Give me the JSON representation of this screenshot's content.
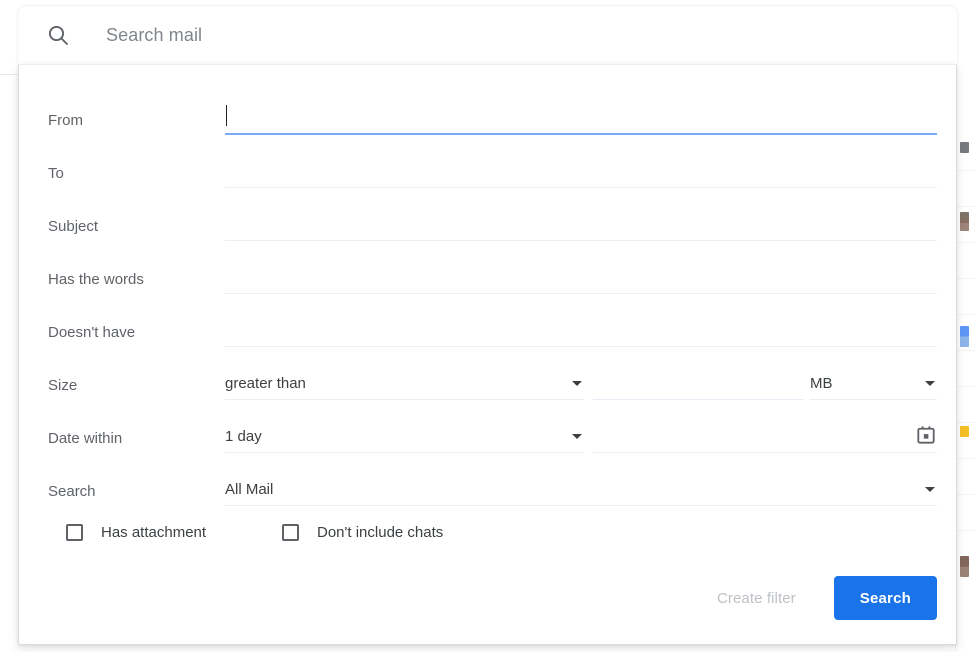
{
  "search_bar": {
    "icon": "search-icon",
    "placeholder": "Search mail",
    "value": ""
  },
  "dialog": {
    "fields": [
      {
        "label": "From",
        "value": "",
        "type": "text",
        "focused": true
      },
      {
        "label": "To",
        "value": "",
        "type": "text",
        "focused": false
      },
      {
        "label": "Subject",
        "value": "",
        "type": "text",
        "focused": false
      },
      {
        "label": "Has the words",
        "value": "",
        "type": "text",
        "focused": false
      },
      {
        "label": "Doesn't have",
        "value": "",
        "type": "text",
        "focused": false
      }
    ],
    "size_row": {
      "label": "Size",
      "operator": "greater than",
      "amount": "",
      "unit": "MB"
    },
    "date_row": {
      "label": "Date within",
      "range": "1 day",
      "date": "",
      "date_icon": "calendar-icon"
    },
    "scope_row": {
      "label": "Search",
      "value": "All Mail"
    },
    "checkboxes": [
      {
        "label": "Has attachment",
        "checked": false
      },
      {
        "label": "Don't include chats",
        "checked": false
      }
    ],
    "footer": {
      "create_filter_label": "Create filter",
      "search_label": "Search"
    }
  },
  "colors": {
    "primary": "#1a73e8",
    "focus_underline": "#7baaf7",
    "label_text": "#5f6368",
    "value_text": "#3c4043",
    "disabled_text": "#bdc1c6",
    "field_underline": "#eceff1"
  }
}
